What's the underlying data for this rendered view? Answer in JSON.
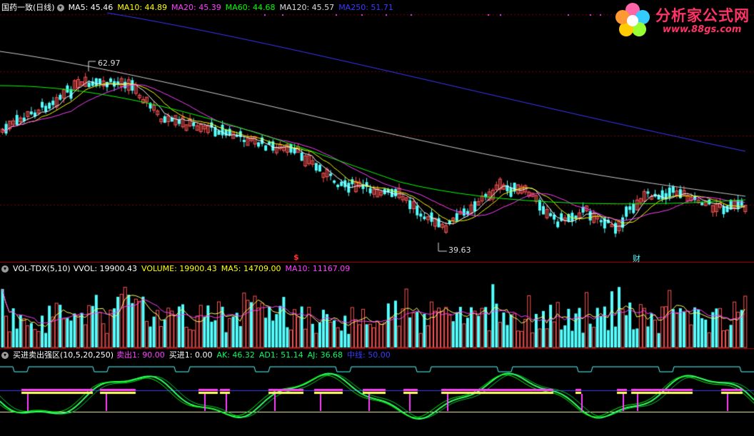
{
  "colors": {
    "bg": "#000000",
    "up": "#ff5555",
    "down": "#54ffff",
    "ma5": "#ffffff",
    "ma10": "#ffff00",
    "ma20": "#ff40ff",
    "ma60": "#00ff00",
    "ma120": "#cccccc",
    "ma250": "#3a3aff",
    "divider": "#b00000",
    "grid": "#7a0000"
  },
  "main": {
    "title": "国药一致(日线)",
    "ma_labels": [
      {
        "text": "MA5: 45.46",
        "color": "#ffffff"
      },
      {
        "text": "MA10: 44.89",
        "color": "#ffff00"
      },
      {
        "text": "MA20: 45.39",
        "color": "#ff40ff"
      },
      {
        "text": "MA60: 44.68",
        "color": "#00ff00"
      },
      {
        "text": "MA120: 45.57",
        "color": "#dddddd"
      },
      {
        "text": "MA250: 51.71",
        "color": "#3a3aff"
      }
    ],
    "high_label": "62.97",
    "low_label": "39.63",
    "marker_s": "$",
    "marker_cai": "财"
  },
  "logo": {
    "name": "分析家公式网",
    "url": "www.88gs.com"
  },
  "volume": {
    "title": "VOL-TDX(5,10)",
    "labels": [
      {
        "text": "VVOL: 19900.43",
        "color": "#ffffff"
      },
      {
        "text": "VOLUME: 19900.43",
        "color": "#ffff00"
      },
      {
        "text": "MA5: 14709.00",
        "color": "#ffff00"
      },
      {
        "text": "MA10: 11167.09",
        "color": "#ff40ff"
      }
    ]
  },
  "indicator": {
    "title": "买进卖出强区(10,5,20,250)",
    "labels": [
      {
        "text": "卖出1: 90.00",
        "color": "#ff40ff"
      },
      {
        "text": "买进1: 0.00",
        "color": "#ffffff"
      },
      {
        "text": "AK: 46.32",
        "color": "#00ff66"
      },
      {
        "text": "AD1: 51.14",
        "color": "#00ff66"
      },
      {
        "text": "AJ: 36.68",
        "color": "#00ff66"
      },
      {
        "text": "中线: 50.00",
        "color": "#3a3aff"
      }
    ]
  }
}
